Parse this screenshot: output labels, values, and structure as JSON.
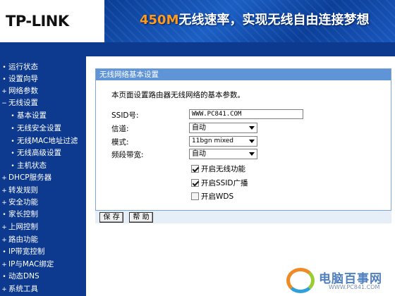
{
  "header": {
    "logo": "TP-LINK",
    "banner_accent": "450M",
    "banner_text": "无线速率，实现无线自由连接梦想"
  },
  "sidebar": {
    "items": [
      {
        "label": "运行状态",
        "bullet": "•"
      },
      {
        "label": "设置向导",
        "bullet": "•"
      },
      {
        "label": "网络参数",
        "bullet": "+"
      },
      {
        "label": "无线设置",
        "bullet": "−"
      },
      {
        "label": "基本设置",
        "bullet": "•"
      },
      {
        "label": "无线安全设置",
        "bullet": "•"
      },
      {
        "label": "无线MAC地址过滤",
        "bullet": "•"
      },
      {
        "label": "无线高级设置",
        "bullet": "•"
      },
      {
        "label": "主机状态",
        "bullet": "•"
      },
      {
        "label": "DHCP服务器",
        "bullet": "+"
      },
      {
        "label": "转发规则",
        "bullet": "+"
      },
      {
        "label": "安全功能",
        "bullet": "+"
      },
      {
        "label": "家长控制",
        "bullet": "•"
      },
      {
        "label": "上网控制",
        "bullet": "+"
      },
      {
        "label": "路由功能",
        "bullet": "+"
      },
      {
        "label": "IP带宽控制",
        "bullet": "•"
      },
      {
        "label": "IP与MAC绑定",
        "bullet": "+"
      },
      {
        "label": "动态DNS",
        "bullet": "•"
      },
      {
        "label": "系统工具",
        "bullet": "+"
      }
    ]
  },
  "panel": {
    "title": "无线网络基本设置",
    "description": "本页面设置路由器无线网络的基本参数。",
    "ssid_label": "SSID号:",
    "ssid_value": "WWW.PC841.COM",
    "channel_label": "信道:",
    "channel_value": "自动",
    "mode_label": "模式:",
    "mode_value": "11bgn mixed",
    "bandwidth_label": "频段带宽:",
    "bandwidth_value": "自动",
    "enable_wireless_label": "开启无线功能",
    "enable_wireless_checked": true,
    "enable_ssid_broadcast_label": "开启SSID广播",
    "enable_ssid_broadcast_checked": true,
    "enable_wds_label": "开启WDS",
    "enable_wds_checked": false,
    "save_label": "保 存",
    "help_label": "帮 助"
  },
  "watermark": {
    "title": "电脑百事网",
    "url": "WWW.PC841.COM"
  }
}
